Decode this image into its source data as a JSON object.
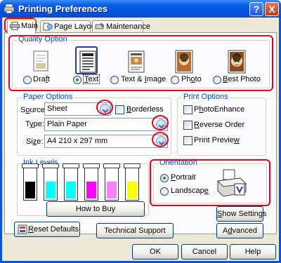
{
  "window": {
    "title": "Printing Preferences"
  },
  "title_buttons": {
    "help": "?",
    "close": "X"
  },
  "tabs": [
    {
      "label": "Main",
      "icon": "printer-icon"
    },
    {
      "label": "Page Layout",
      "icon": "page-layout-icon"
    },
    {
      "label": "Maintenance",
      "icon": "maintenance-icon"
    }
  ],
  "quality": {
    "title": "Quality Option",
    "options": [
      {
        "label": "Draft",
        "underline": "f",
        "icon": "draft-page-icon"
      },
      {
        "label": "Text",
        "underline": "T",
        "icon": "text-page-icon"
      },
      {
        "label": "Text & Image",
        "underline": "I",
        "icon": "text-image-page-icon"
      },
      {
        "label": "Photo",
        "underline": "o",
        "icon": "photo-page-icon"
      },
      {
        "label": "Best Photo",
        "underline": "B",
        "icon": "best-photo-page-icon"
      }
    ],
    "selected": "Text"
  },
  "paper": {
    "title": "Paper Options",
    "source_label": "Source:",
    "source_value": "Sheet",
    "borderless_label": "Borderless",
    "type_label": "Type:",
    "type_value": "Plain Paper",
    "size_label": "Size:",
    "size_value": "A4 210 x 297 mm"
  },
  "print_options": {
    "title": "Print Options",
    "photo_enhance": "PhotoEnhance",
    "reverse_order": "Reverse Order",
    "print_preview": "Print Preview"
  },
  "ink": {
    "title": "Ink Levels",
    "colors": [
      "#000000",
      "#00ffff",
      "#00ffff",
      "#ff00ff",
      "#ff80ff",
      "#ffff00"
    ],
    "how_to_buy": "How to Buy"
  },
  "orientation": {
    "title": "Orientation",
    "portrait": "Portrait",
    "landscape": "Landscape",
    "selected": "Portrait"
  },
  "buttons": {
    "show_settings": "Show Settings",
    "reset_defaults": "Reset Defaults",
    "technical_support": "Technical Support",
    "advanced": "Advanced",
    "ok": "OK",
    "cancel": "Cancel",
    "help": "Help"
  },
  "highlight_color": "#e8001c"
}
